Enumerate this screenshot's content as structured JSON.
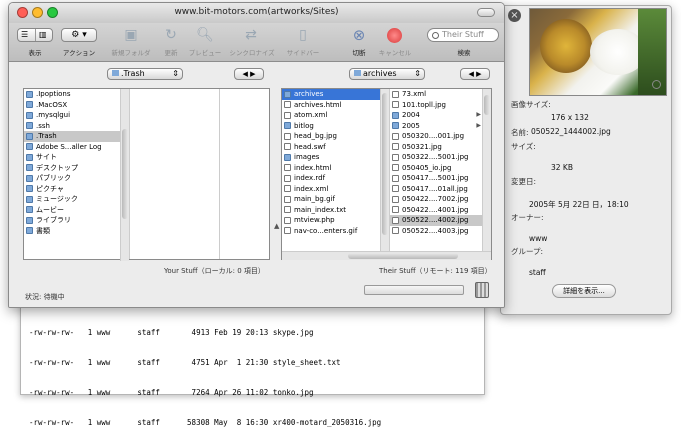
{
  "window": {
    "title": "www.bit-motors.com(artworks/Sites)"
  },
  "toolbar": {
    "view_label": "表示",
    "action_label": "アクション",
    "new_folder_label": "新規フォルダ",
    "refresh_label": "更新",
    "preview_label": "プレビュー",
    "sync_label": "シンクロナイズ",
    "sidebar_label": "サイドバー",
    "disconnect_label": "切断",
    "cancel_label": "キャンセル",
    "search_placeholder": "Their Stuff",
    "search_label": "検索"
  },
  "local": {
    "path": ".Trash",
    "col1": [
      {
        "name": ".Ipoptions",
        "type": "dir"
      },
      {
        "name": ".MacOSX",
        "type": "dir"
      },
      {
        "name": ".mysqlgui",
        "type": "dir"
      },
      {
        "name": ".ssh",
        "type": "dir"
      },
      {
        "name": ".Trash",
        "type": "dir",
        "state": "sel"
      },
      {
        "name": "Adobe S...aller Log",
        "type": "dir"
      },
      {
        "name": "サイト",
        "type": "dir"
      },
      {
        "name": "デスクトップ",
        "type": "dir"
      },
      {
        "name": "パブリック",
        "type": "dir"
      },
      {
        "name": "ピクチャ",
        "type": "dir"
      },
      {
        "name": "ミュージック",
        "type": "dir"
      },
      {
        "name": "ムービー",
        "type": "dir"
      },
      {
        "name": "ライブラリ",
        "type": "dir"
      },
      {
        "name": "書類",
        "type": "dir"
      }
    ],
    "footer": "Your Stuff（ローカル: 0 項目）"
  },
  "remote": {
    "path": "archives",
    "col1": [
      {
        "name": "archives",
        "type": "dir",
        "state": "hl"
      },
      {
        "name": "archives.html",
        "type": "file"
      },
      {
        "name": "atom.xml",
        "type": "file"
      },
      {
        "name": "bitlog",
        "type": "dir"
      },
      {
        "name": "head_bg.jpg",
        "type": "file"
      },
      {
        "name": "head.swf",
        "type": "file"
      },
      {
        "name": "images",
        "type": "dir"
      },
      {
        "name": "index.html",
        "type": "file"
      },
      {
        "name": "index.rdf",
        "type": "file"
      },
      {
        "name": "index.xml",
        "type": "file"
      },
      {
        "name": "main_bg.gif",
        "type": "file"
      },
      {
        "name": "main_index.txt",
        "type": "file"
      },
      {
        "name": "mtview.php",
        "type": "file"
      },
      {
        "name": "nav-co...enters.gif",
        "type": "file"
      }
    ],
    "col2": [
      {
        "name": "73.xml",
        "type": "file"
      },
      {
        "name": "101.topll.jpg",
        "type": "file"
      },
      {
        "name": "2004",
        "type": "dir"
      },
      {
        "name": "2005",
        "type": "dir"
      },
      {
        "name": "050320....001.jpg",
        "type": "file"
      },
      {
        "name": "050321.jpg",
        "type": "file"
      },
      {
        "name": "050322....5001.jpg",
        "type": "file"
      },
      {
        "name": "050405_io.jpg",
        "type": "file"
      },
      {
        "name": "050417....5001.jpg",
        "type": "file"
      },
      {
        "name": "050417....01all.jpg",
        "type": "file"
      },
      {
        "name": "050422....7002.jpg",
        "type": "file"
      },
      {
        "name": "050422....4001.jpg",
        "type": "file"
      },
      {
        "name": "050522....4002.jpg",
        "type": "file",
        "state": "sel"
      },
      {
        "name": "050522....4003.jpg",
        "type": "file"
      }
    ],
    "footer": "Their Stuff（リモート: 119 項目）"
  },
  "status": {
    "text": "状況: 待機中"
  },
  "nav": {
    "back_fwd": "◀ ▶"
  },
  "info": {
    "kind_label": "画像サイズ:",
    "size_dims": "176 x 132",
    "name_label": "名前:",
    "name_value": "050522_1444002.jpg",
    "size_label": "サイズ:",
    "size_value": "32 KB",
    "modified_label": "変更日:",
    "modified_value": "2005年 5月 22日 日，18:10",
    "owner_label": "オーナー:",
    "owner_value": "www",
    "group_label": "グループ:",
    "group_value": "staff",
    "details_button": "詳細を表示..."
  },
  "terminal": {
    "lines": [
      "-rw-rw-rw-   1 www      staff       4913 Feb 19 20:13 skype.jpg",
      "-rw-rw-rw-   1 www      staff       4751 Apr  1 21:30 style_sheet.txt",
      "-rw-rw-rw-   1 www      staff       7264 Apr 26 11:02 tonko.jpg",
      "-rw-rw-rw-   1 www      staff      58308 May  8 16:30 xr400-motard_2050316.jpg"
    ]
  },
  "colors": {
    "selection_blue": "#3875d7",
    "selection_grey": "#c8c8c8",
    "folder_blue": "#7fa9d9"
  }
}
